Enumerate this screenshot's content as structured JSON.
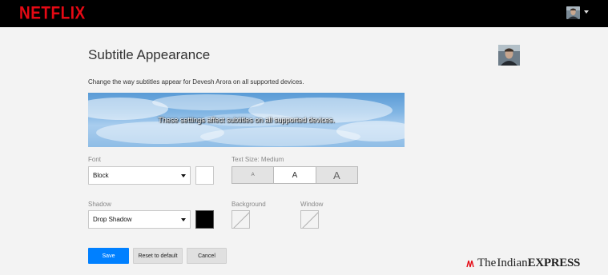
{
  "brand": {
    "logo": "NETFLIX",
    "color": "#e50914"
  },
  "header": {
    "profile_icon": "profile-avatar-icon",
    "menu_icon": "caret-down-icon"
  },
  "page": {
    "title": "Subtitle Appearance",
    "description": "Change the way subtitles appear for Devesh Arora on all supported devices."
  },
  "preview": {
    "text": "These settings affect subtitles on all supported devices."
  },
  "font": {
    "label": "Font",
    "value": "Block",
    "color": "#ffffff"
  },
  "text_size": {
    "label": "Text Size: Medium",
    "options": [
      "A",
      "A",
      "A"
    ],
    "selected_index": 1
  },
  "shadow": {
    "label": "Shadow",
    "value": "Drop Shadow",
    "color": "#000000"
  },
  "background": {
    "label": "Background"
  },
  "window": {
    "label": "Window"
  },
  "actions": {
    "save": "Save",
    "reset": "Reset to default",
    "cancel": "Cancel"
  },
  "watermark": {
    "prefix": "The",
    "name": "Indian",
    "suffix": "EXPRESS"
  }
}
